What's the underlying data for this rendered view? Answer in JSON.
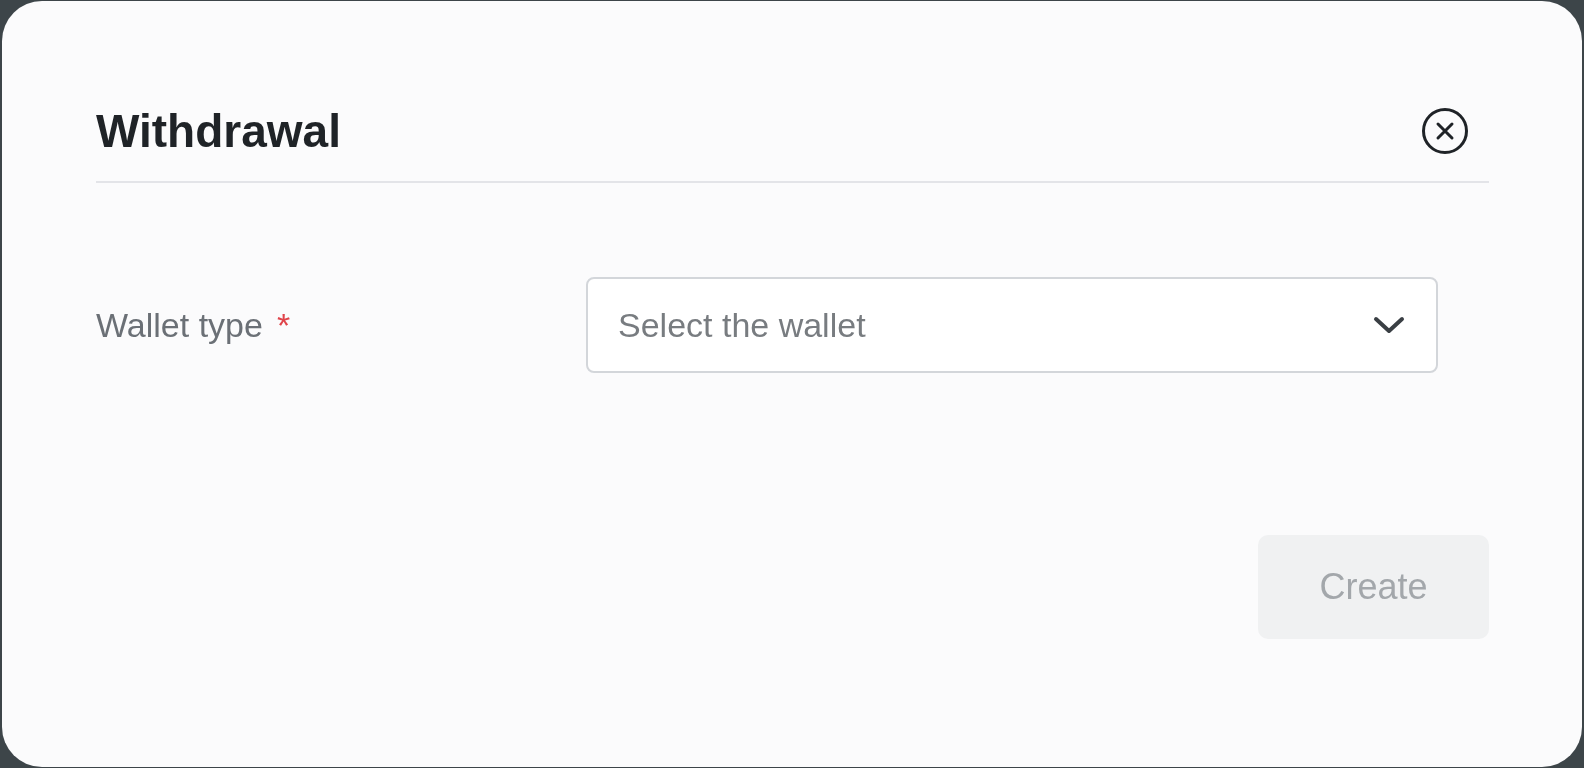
{
  "dialog": {
    "title": "Withdrawal"
  },
  "fields": [
    {
      "label": "Wallet type",
      "required_mark": "*",
      "placeholder": "Select the wallet"
    }
  ],
  "buttons": [
    {
      "label": "Create",
      "disabled": true
    }
  ]
}
